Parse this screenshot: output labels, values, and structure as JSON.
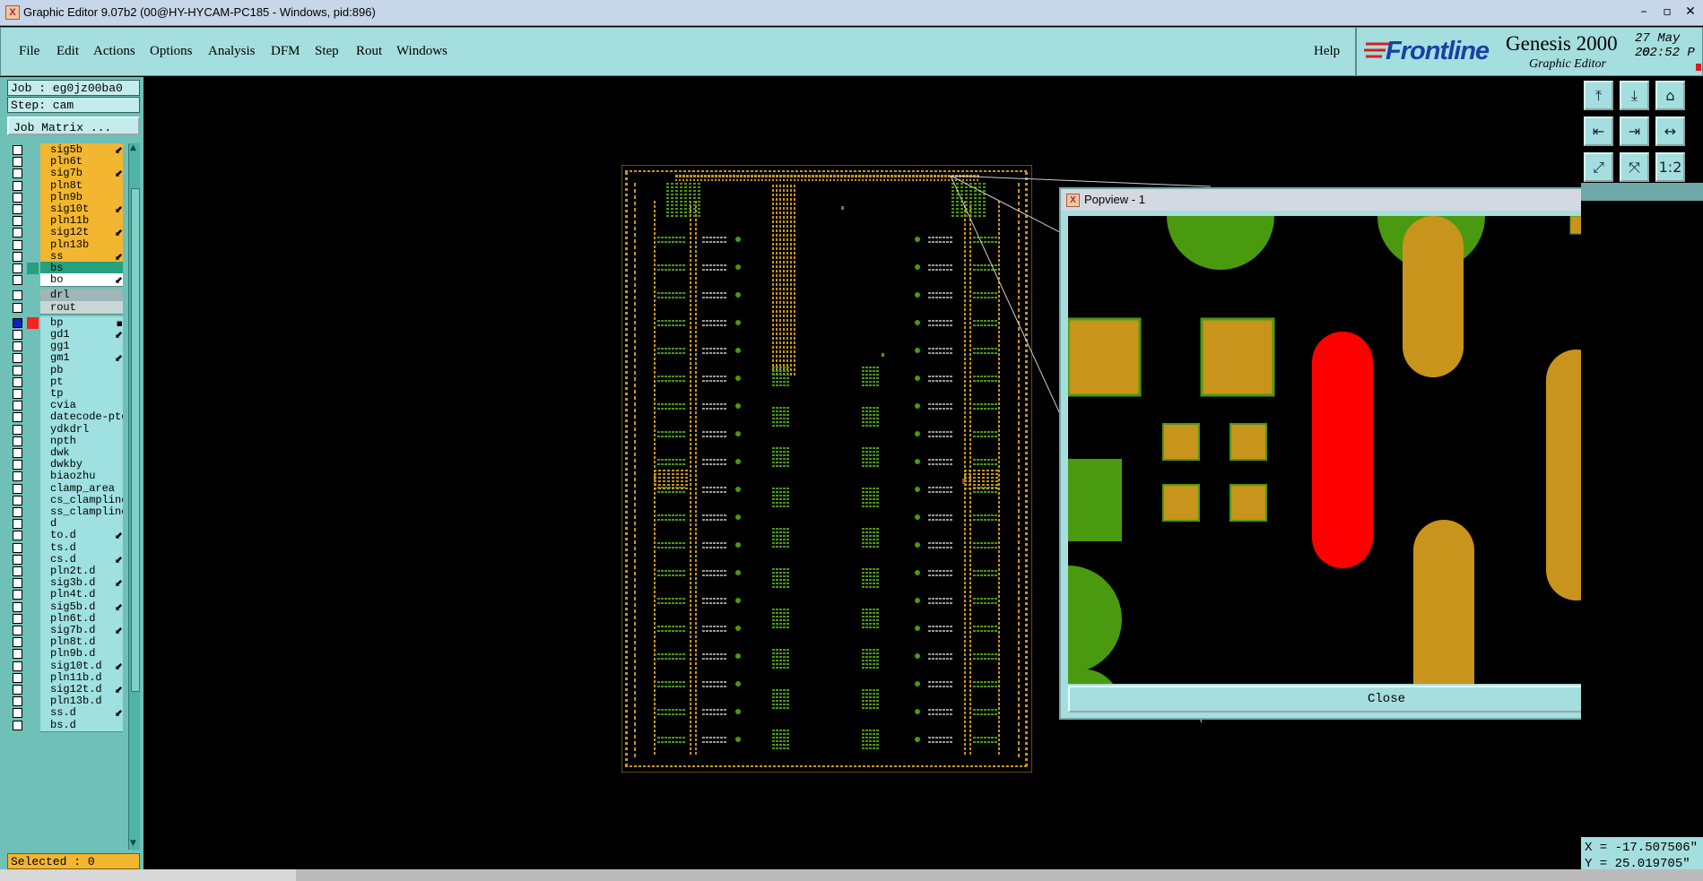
{
  "window": {
    "title": "Graphic Editor 9.07b2 (00@HY-HYCAM-PC185 - Windows, pid:896)",
    "app_icon": "X"
  },
  "menu": {
    "items": [
      "File",
      "Edit",
      "Actions",
      "Options",
      "Analysis",
      "DFM",
      "Step",
      "Rout",
      "Windows"
    ],
    "help": "Help"
  },
  "brand": {
    "logo": "Frontline",
    "product": "Genesis 2000",
    "subtitle": "Graphic Editor",
    "date": "27 May 20",
    "time": "02:52 P"
  },
  "job": {
    "job_label": "Job : eg0jz00ba0",
    "step_label": "Step: cam",
    "matrix_button": "Job Matrix ..."
  },
  "layers_group1": [
    {
      "name": "sig5b",
      "color": "#f2b630",
      "flag": "⬋"
    },
    {
      "name": "pln6t",
      "color": "#f2b630",
      "flag": ""
    },
    {
      "name": "sig7b",
      "color": "#f2b630",
      "flag": "⬋"
    },
    {
      "name": "pln8t",
      "color": "#f2b630",
      "flag": ""
    },
    {
      "name": "pln9b",
      "color": "#f2b630",
      "flag": ""
    },
    {
      "name": "sig10t",
      "color": "#f2b630",
      "flag": "⬋"
    },
    {
      "name": "pln11b",
      "color": "#f2b630",
      "flag": ""
    },
    {
      "name": "sig12t",
      "color": "#f2b630",
      "flag": "⬋"
    },
    {
      "name": "pln13b",
      "color": "#f2b630",
      "flag": ""
    },
    {
      "name": "ss",
      "color": "#f2b630",
      "flag": "⬋"
    },
    {
      "name": "bs",
      "color": "#27a07e",
      "flag": ""
    },
    {
      "name": "bo",
      "color": "#ffffff",
      "flag": "⬋"
    }
  ],
  "layers_group2": [
    {
      "name": "drl",
      "color": "#9fb5b8",
      "flag": ""
    },
    {
      "name": "rout",
      "color": "#c9d6d6",
      "flag": ""
    }
  ],
  "layers_group3": [
    {
      "name": "bp",
      "color": "#9fe0e0",
      "flag": "▪"
    },
    {
      "name": "gd1",
      "color": "#9fe0e0",
      "flag": "⬋"
    },
    {
      "name": "gg1",
      "color": "#9fe0e0",
      "flag": ""
    },
    {
      "name": "gm1",
      "color": "#9fe0e0",
      "flag": "⬋"
    },
    {
      "name": "pb",
      "color": "#9fe0e0",
      "flag": ""
    },
    {
      "name": "pt",
      "color": "#9fe0e0",
      "flag": ""
    },
    {
      "name": "tp",
      "color": "#9fe0e0",
      "flag": ""
    },
    {
      "name": "cvia",
      "color": "#9fe0e0",
      "flag": ""
    },
    {
      "name": "datecode-pte",
      "color": "#9fe0e0",
      "flag": ""
    },
    {
      "name": "ydkdrl",
      "color": "#9fe0e0",
      "flag": ""
    },
    {
      "name": "npth",
      "color": "#9fe0e0",
      "flag": ""
    },
    {
      "name": "dwk",
      "color": "#9fe0e0",
      "flag": ""
    },
    {
      "name": "dwkby",
      "color": "#9fe0e0",
      "flag": ""
    },
    {
      "name": "biaozhu",
      "color": "#9fe0e0",
      "flag": ""
    },
    {
      "name": "clamp_area",
      "color": "#9fe0e0",
      "flag": ""
    },
    {
      "name": "cs_clampline",
      "color": "#9fe0e0",
      "flag": ""
    },
    {
      "name": "ss_clampline",
      "color": "#9fe0e0",
      "flag": ""
    },
    {
      "name": "d",
      "color": "#9fe0e0",
      "flag": ""
    },
    {
      "name": "to.d",
      "color": "#9fe0e0",
      "flag": "⬋"
    },
    {
      "name": "ts.d",
      "color": "#9fe0e0",
      "flag": ""
    },
    {
      "name": "cs.d",
      "color": "#9fe0e0",
      "flag": "⬋"
    },
    {
      "name": "pln2t.d",
      "color": "#9fe0e0",
      "flag": ""
    },
    {
      "name": "sig3b.d",
      "color": "#9fe0e0",
      "flag": "⬋"
    },
    {
      "name": "pln4t.d",
      "color": "#9fe0e0",
      "flag": ""
    },
    {
      "name": "sig5b.d",
      "color": "#9fe0e0",
      "flag": "⬋"
    },
    {
      "name": "pln6t.d",
      "color": "#9fe0e0",
      "flag": ""
    },
    {
      "name": "sig7b.d",
      "color": "#9fe0e0",
      "flag": "⬋"
    },
    {
      "name": "pln8t.d",
      "color": "#9fe0e0",
      "flag": ""
    },
    {
      "name": "pln9b.d",
      "color": "#9fe0e0",
      "flag": ""
    },
    {
      "name": "sig10t.d",
      "color": "#9fe0e0",
      "flag": "⬋"
    },
    {
      "name": "pln11b.d",
      "color": "#9fe0e0",
      "flag": ""
    },
    {
      "name": "sig12t.d",
      "color": "#9fe0e0",
      "flag": "⬋"
    },
    {
      "name": "pln13b.d",
      "color": "#9fe0e0",
      "flag": ""
    },
    {
      "name": "ss.d",
      "color": "#9fe0e0",
      "flag": "⬋"
    },
    {
      "name": "bs.d",
      "color": "#9fe0e0",
      "flag": ""
    }
  ],
  "status": {
    "selected": "Selected : 0"
  },
  "popview": {
    "title": "Popview - 1",
    "close_button": "Close"
  },
  "toolbar": {
    "buttons": [
      "⤒",
      "⤓",
      "⌂",
      "⇤",
      "⇥",
      "↔",
      "⤢",
      "⤧",
      "1:2"
    ]
  },
  "coords": {
    "x": "X = -17.507506\"",
    "y": "Y = 25.019705\""
  },
  "colors": {
    "menu_bg": "#a5dede",
    "board_copper": "#c8941b",
    "pad_green": "#4a9a10",
    "highlight_red": "#ff0000"
  }
}
